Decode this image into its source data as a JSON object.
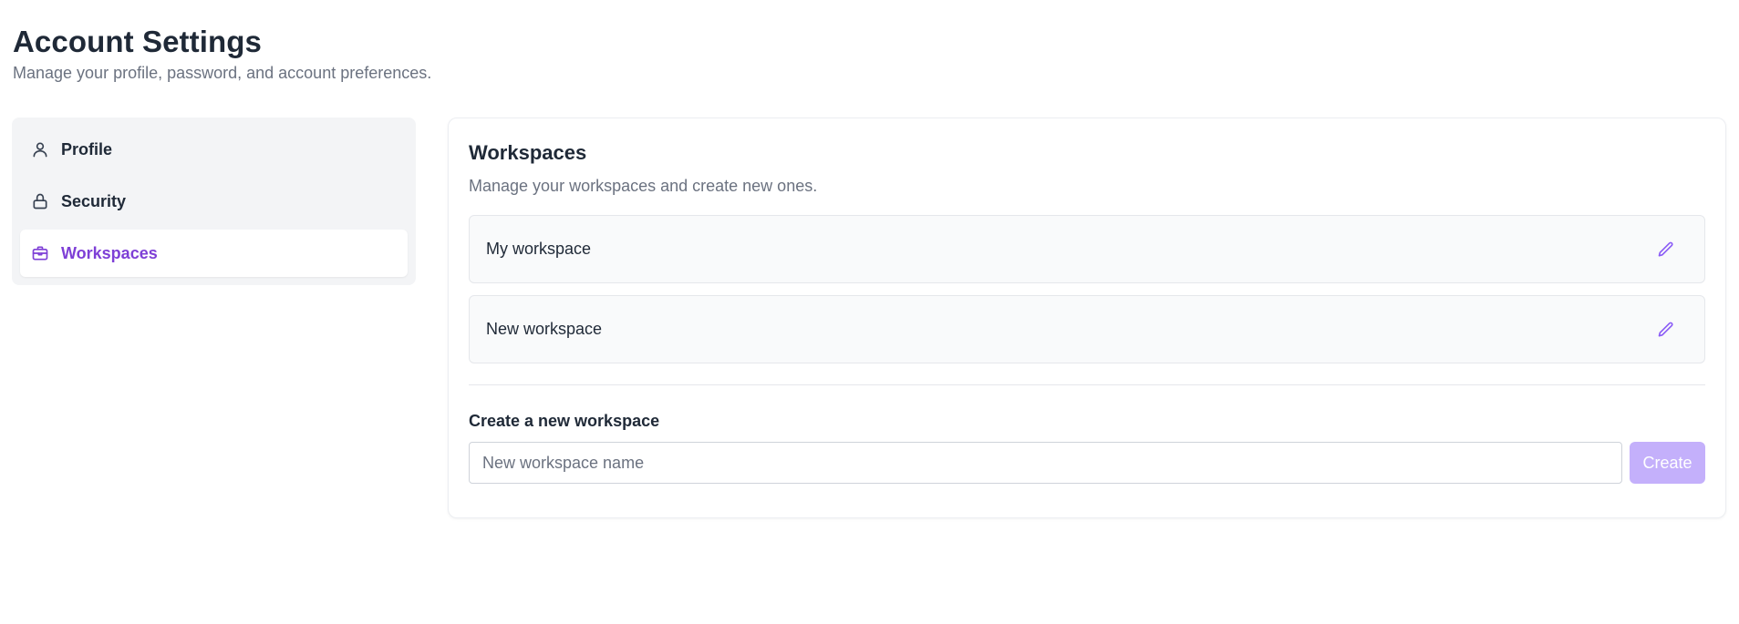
{
  "header": {
    "title": "Account Settings",
    "subtitle": "Manage your profile, password, and account preferences."
  },
  "sidebar": {
    "items": [
      {
        "label": "Profile",
        "icon": "user-icon",
        "active": false
      },
      {
        "label": "Security",
        "icon": "lock-icon",
        "active": false
      },
      {
        "label": "Workspaces",
        "icon": "briefcase-icon",
        "active": true
      }
    ]
  },
  "workspaces": {
    "title": "Workspaces",
    "subtitle": "Manage your workspaces and create new ones.",
    "items": [
      {
        "name": "My workspace",
        "action_icon": "pencil-icon"
      },
      {
        "name": "New workspace",
        "action_icon": "pencil-icon"
      }
    ],
    "create": {
      "label": "Create a new workspace",
      "input_value": "",
      "input_placeholder": "New workspace name",
      "button_label": "Create"
    }
  },
  "colors": {
    "accent": "#7e3fd6",
    "accent_light": "#8b5cf6",
    "button_disabled": "#c4b0fb",
    "muted_text": "#6b7280",
    "text": "#1f2937",
    "sidebar_bg": "#f3f4f6"
  }
}
